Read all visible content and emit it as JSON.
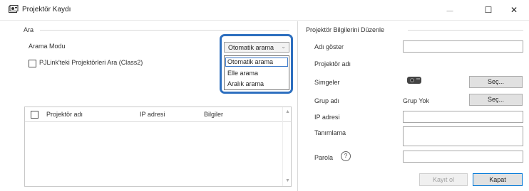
{
  "window": {
    "title": "Projektör Kaydı",
    "minimize_glyph": "—",
    "maximize_glyph": "☐",
    "close_glyph": "✕"
  },
  "search": {
    "group_label": "Ara",
    "mode_label": "Arama Modu",
    "mode_selected": "Otomatik arama",
    "mode_options": [
      "Otomatik arama",
      "Elle arama",
      "Aralık arama"
    ],
    "pjlink_label": "PJLink'teki Projektörleri Ara (Class2)",
    "pjlink_checked": false
  },
  "table": {
    "columns": [
      "Projektör adı",
      "IP adresi",
      "Bilgiler"
    ],
    "rows": []
  },
  "edit": {
    "group_label": "Projektör Bilgilerini Düzenle",
    "display_name_label": "Adı göster",
    "display_name_value": "",
    "projector_name_label": "Projektör adı",
    "icons_label": "Simgeler",
    "icons_button": "Seç...",
    "group_name_label": "Grup adı",
    "group_name_value": "Grup Yok",
    "group_button": "Seç...",
    "ip_label": "IP adresi",
    "ip_value": "",
    "description_label": "Tanımlama",
    "description_value": "",
    "password_label": "Parola",
    "password_help_glyph": "?",
    "password_value": "",
    "register_button": "Kayıt ol",
    "close_button": "Kapat"
  },
  "colors": {
    "highlight": "#2d6fbf",
    "selection_outline": "#3a78c9",
    "primary_border": "#0078d7"
  }
}
